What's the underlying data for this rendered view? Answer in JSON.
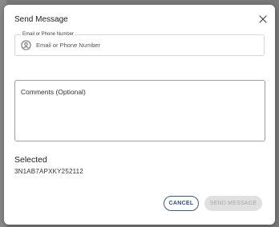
{
  "dialog": {
    "title": "Send Message",
    "contact_field": {
      "label": "Email or Phone Number",
      "placeholder": "Email or Phone Number",
      "icon": "person-circle-icon"
    },
    "comments": {
      "placeholder": "Comments (Optional)"
    },
    "selected": {
      "label": "Selected",
      "value": "3N1AB7APXKY252112"
    },
    "actions": {
      "cancel_label": "CANCEL",
      "send_label": "SEND MESSAGE",
      "send_enabled": false
    },
    "colors": {
      "accent": "#2c4f86",
      "disabled_bg": "#e0e0e0",
      "disabled_text": "#a7a7a7"
    }
  }
}
